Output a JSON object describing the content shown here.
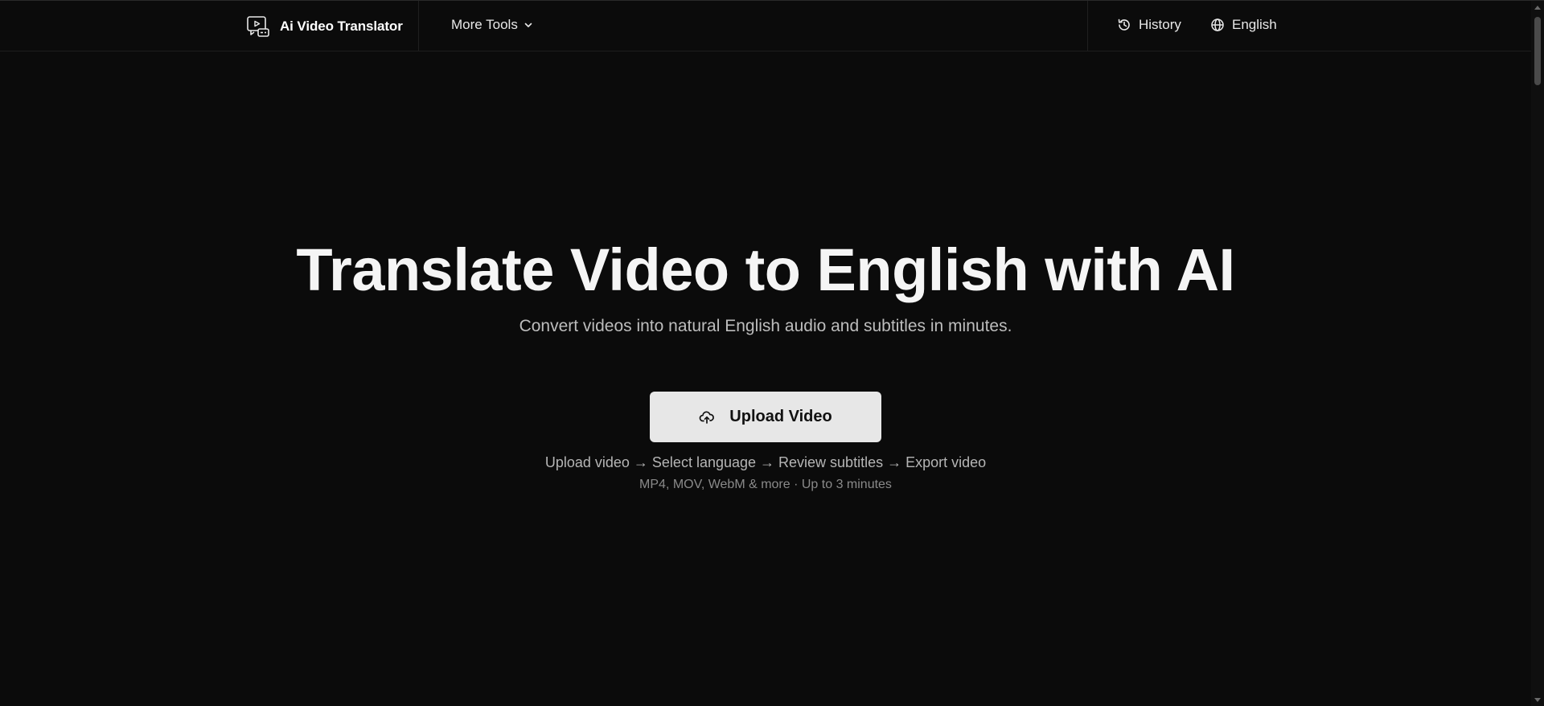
{
  "header": {
    "brand_name": "Ai Video Translator",
    "brand_icon": "video-translate-icon",
    "more_tools_label": "More Tools",
    "history_label": "History",
    "language_label": "English"
  },
  "hero": {
    "title": "Translate Video to English with AI",
    "subtitle": "Convert videos into natural English audio and subtitles in minutes.",
    "upload_label": "Upload Video",
    "steps": "Upload video → Select language → Review subtitles → Export video",
    "formats": "MP4, MOV, WebM & more · Up to 3 minutes"
  },
  "colors": {
    "background": "#0b0b0b",
    "button_bg": "#e7e7e7",
    "text_primary": "#f5f5f5",
    "text_secondary": "#bdbdbd"
  }
}
